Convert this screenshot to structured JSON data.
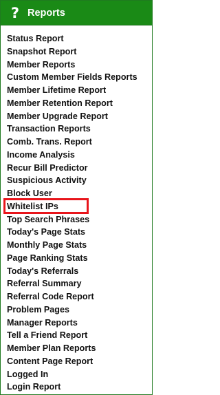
{
  "header": {
    "icon": "question-mark-icon",
    "icon_glyph": "?",
    "title": "Reports",
    "background_color": "#1a8a16"
  },
  "menu": {
    "items": [
      {
        "label": "Status Report"
      },
      {
        "label": "Snapshot Report"
      },
      {
        "label": "Member Reports"
      },
      {
        "label": "Custom Member Fields Reports"
      },
      {
        "label": "Member Lifetime Report"
      },
      {
        "label": "Member Retention Report"
      },
      {
        "label": "Member Upgrade Report"
      },
      {
        "label": "Transaction Reports"
      },
      {
        "label": "Comb. Trans. Report"
      },
      {
        "label": "Income Analysis"
      },
      {
        "label": "Recur Bill Predictor"
      },
      {
        "label": "Suspicious Activity"
      },
      {
        "label": "Block User"
      },
      {
        "label": "Whitelist IPs",
        "highlighted": true
      },
      {
        "label": "Top Search Phrases"
      },
      {
        "label": "Today's Page Stats"
      },
      {
        "label": "Monthly Page Stats"
      },
      {
        "label": "Page Ranking Stats"
      },
      {
        "label": "Today's Referrals"
      },
      {
        "label": "Referral Summary"
      },
      {
        "label": "Referral Code Report"
      },
      {
        "label": "Problem Pages"
      },
      {
        "label": "Manager Reports"
      },
      {
        "label": "Tell a Friend Report"
      },
      {
        "label": "Member Plan Reports"
      },
      {
        "label": "Content Page Report"
      },
      {
        "label": "Logged In"
      },
      {
        "label": "Login Report"
      }
    ]
  },
  "highlight_color": "#e8151b"
}
